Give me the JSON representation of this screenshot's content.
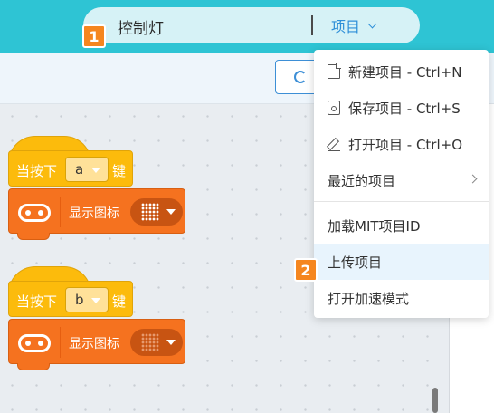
{
  "header": {
    "project_name": "控制灯",
    "project_menu_label": "项目"
  },
  "badges": {
    "first": "1",
    "second": "2"
  },
  "blocks": [
    {
      "hat_label": "当按下",
      "key": "a",
      "hat_suffix": "键",
      "command_label": "显示图标"
    },
    {
      "hat_label": "当按下",
      "key": "b",
      "hat_suffix": "键",
      "command_label": "显示图标"
    }
  ],
  "menu": {
    "items": [
      {
        "label": "新建项目 - Ctrl+N",
        "icon": "new-file-icon"
      },
      {
        "label": "保存项目 - Ctrl+S",
        "icon": "save-icon"
      },
      {
        "label": "打开项目 - Ctrl+O",
        "icon": "edit-icon"
      },
      {
        "label": "最近的项目",
        "icon": "chevron-right-icon"
      },
      {
        "label": "加载MIT项目ID"
      },
      {
        "label": "上传项目",
        "highlighted": true
      },
      {
        "label": "打开加速模式"
      }
    ]
  },
  "colors": {
    "topbar": "#2ec4d4",
    "accent_blue": "#2e8fd8",
    "badge_orange": "#f5861f",
    "event_block": "#fcbb0c",
    "display_block": "#f5721f"
  }
}
